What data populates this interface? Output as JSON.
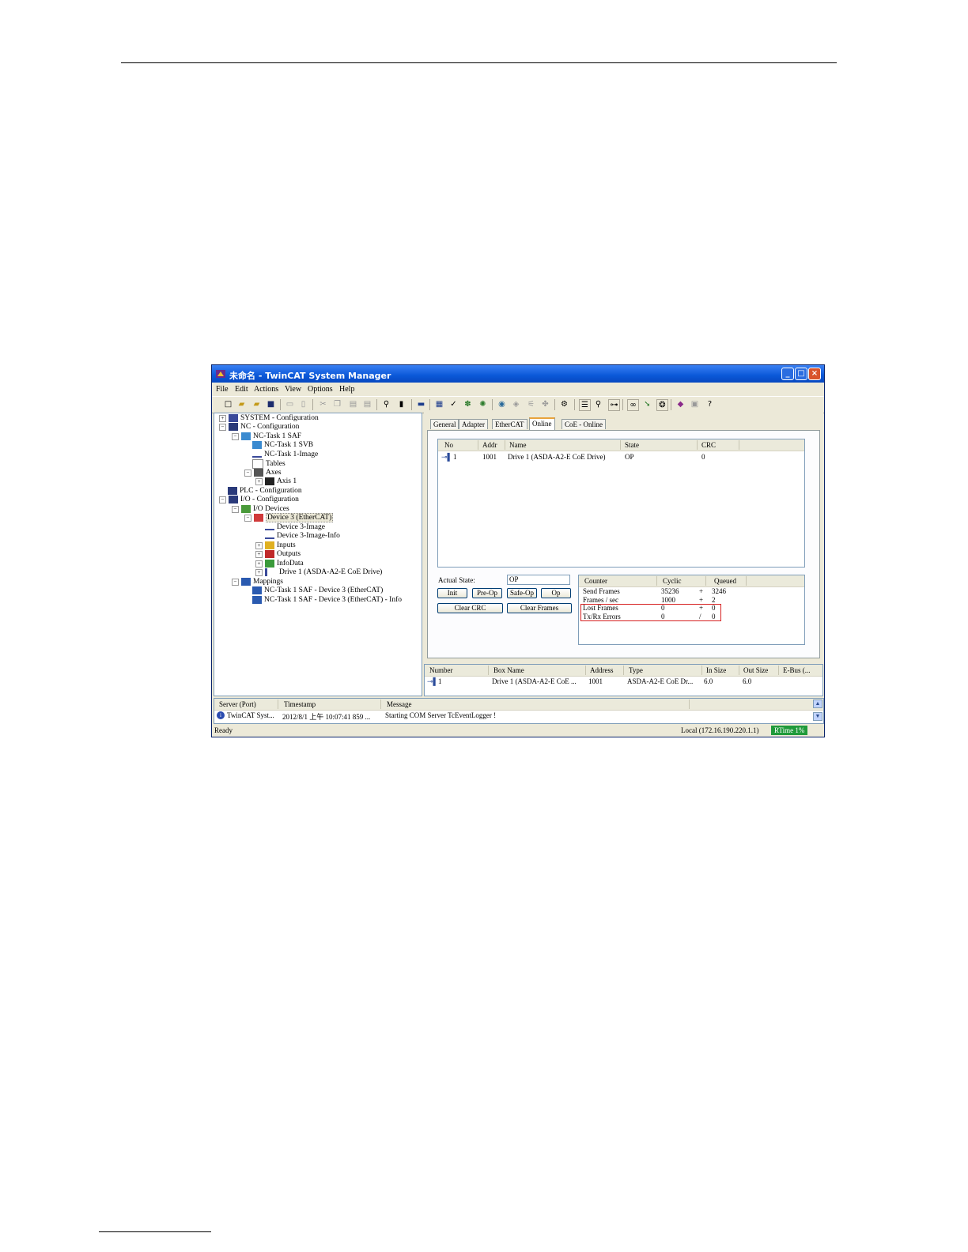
{
  "window": {
    "title": "未命名 - TwinCAT System Manager",
    "controls": {
      "minimize": "_",
      "maximize": "□",
      "close": "×"
    }
  },
  "menu": [
    "File",
    "Edit",
    "Actions",
    "View",
    "Options",
    "Help"
  ],
  "toolbar_icons": [
    "new-icon",
    "open-icon",
    "open-folder-icon",
    "save-icon",
    "print-icon",
    "print-preview-icon",
    "cut-icon",
    "copy-icon",
    "paste-icon",
    "paste-special-icon",
    "find-icon",
    "find-next-icon",
    "target-system-icon",
    "generate-mappings-icon",
    "check-configuration-icon",
    "activate-configuration-icon",
    "set-run-mode-icon",
    "restart-icon",
    "config-mode-icon",
    "scan-icon",
    "add-icon",
    "toggle-free-run-icon",
    "show-online-icon",
    "zoom-icon",
    "network-icon",
    "goggles-icon",
    "cursor-icon",
    "speech-icon",
    "books-icon",
    "help-context-icon",
    "help-icon"
  ],
  "tree": [
    {
      "label": "SYSTEM - Configuration",
      "exp": "+",
      "icon": "system-icon"
    },
    {
      "label": "NC - Configuration",
      "exp": "−",
      "icon": "nc-icon"
    },
    {
      "label": "NC-Task 1 SAF",
      "exp": "−",
      "icon": "task-icon"
    },
    {
      "label": "NC-Task 1 SVB",
      "exp": "",
      "icon": "task-icon"
    },
    {
      "label": "NC-Task 1-Image",
      "exp": "",
      "icon": "image-icon"
    },
    {
      "label": "Tables",
      "exp": "",
      "icon": "table-icon"
    },
    {
      "label": "Axes",
      "exp": "−",
      "icon": "axes-icon"
    },
    {
      "label": "Axis 1",
      "exp": "+",
      "icon": "axis-icon"
    },
    {
      "label": "PLC - Configuration",
      "exp": "",
      "icon": "plc-icon"
    },
    {
      "label": "I/O - Configuration",
      "exp": "−",
      "icon": "io-icon"
    },
    {
      "label": "I/O Devices",
      "exp": "−",
      "icon": "io-devices-icon"
    },
    {
      "label": "Device 3 (EtherCAT)",
      "exp": "−",
      "icon": "ethercat-device-icon"
    },
    {
      "label": "Device 3-Image",
      "exp": "",
      "icon": "image-icon"
    },
    {
      "label": "Device 3-Image-Info",
      "exp": "",
      "icon": "image-icon"
    },
    {
      "label": "Inputs",
      "exp": "+",
      "icon": "inputs-icon"
    },
    {
      "label": "Outputs",
      "exp": "+",
      "icon": "outputs-icon"
    },
    {
      "label": "InfoData",
      "exp": "+",
      "icon": "infodata-icon"
    },
    {
      "label": "Drive 1 (ASDA-A2-E CoE Drive)",
      "exp": "+",
      "icon": "drive-icon"
    },
    {
      "label": "Mappings",
      "exp": "−",
      "icon": "mappings-icon"
    },
    {
      "label": "NC-Task 1 SAF - Device 3 (EtherCAT)",
      "exp": "",
      "icon": "mapping-icon"
    },
    {
      "label": "NC-Task 1 SAF - Device 3 (EtherCAT) - Info",
      "exp": "",
      "icon": "mapping-icon"
    }
  ],
  "tabs": [
    "General",
    "Adapter",
    "EtherCAT",
    "Online",
    "CoE - Online"
  ],
  "online": {
    "columns": [
      "No",
      "Addr",
      "Name",
      "State",
      "CRC"
    ],
    "rows": [
      {
        "no": "1",
        "addr": "1001",
        "name": "Drive 1 (ASDA-A2-E CoE Drive)",
        "state": "OP",
        "crc": "0"
      }
    ],
    "actual_state_label": "Actual State:",
    "actual_state_value": "OP",
    "buttons": {
      "init": "Init",
      "preop": "Pre-Op",
      "safeop": "Safe-Op",
      "op": "Op",
      "clear_crc": "Clear CRC",
      "clear_frames": "Clear Frames"
    },
    "counter_columns": [
      "Counter",
      "Cyclic",
      "Queued"
    ],
    "counters": [
      {
        "name": "Send Frames",
        "cyclic": "35236",
        "op": "+",
        "queued": "3246"
      },
      {
        "name": "Frames / sec",
        "cyclic": "1000",
        "op": "+",
        "queued": "2"
      },
      {
        "name": "Lost Frames",
        "cyclic": "0",
        "op": "+",
        "queued": "0"
      },
      {
        "name": "Tx/Rx Errors",
        "cyclic": "0",
        "op": "/",
        "queued": "0"
      }
    ]
  },
  "boxes": {
    "columns": [
      "Number",
      "Box Name",
      "Address",
      "Type",
      "In Size",
      "Out Size",
      "E-Bus (..."
    ],
    "rows": [
      {
        "number": "1",
        "box_name": "Drive 1 (ASDA-A2-E CoE ...",
        "address": "1001",
        "type": "ASDA-A2-E CoE Dr...",
        "in_size": "6.0",
        "out_size": "6.0"
      }
    ]
  },
  "log": {
    "columns": [
      "Server (Port)",
      "Timestamp",
      "Message"
    ],
    "rows": [
      {
        "server": "TwinCAT Syst...",
        "timestamp": "2012/8/1 上午 10:07:41 859 ...",
        "message": "Starting COM Server TcEventLogger !"
      }
    ]
  },
  "status": {
    "left": "Ready",
    "local": "Local (172.16.190.220.1.1)",
    "rtime": "RTime 1%"
  },
  "colors": {
    "titlebar": "#0a58d8",
    "highlight": "#d62020",
    "rtime": "#1f9a3a"
  }
}
